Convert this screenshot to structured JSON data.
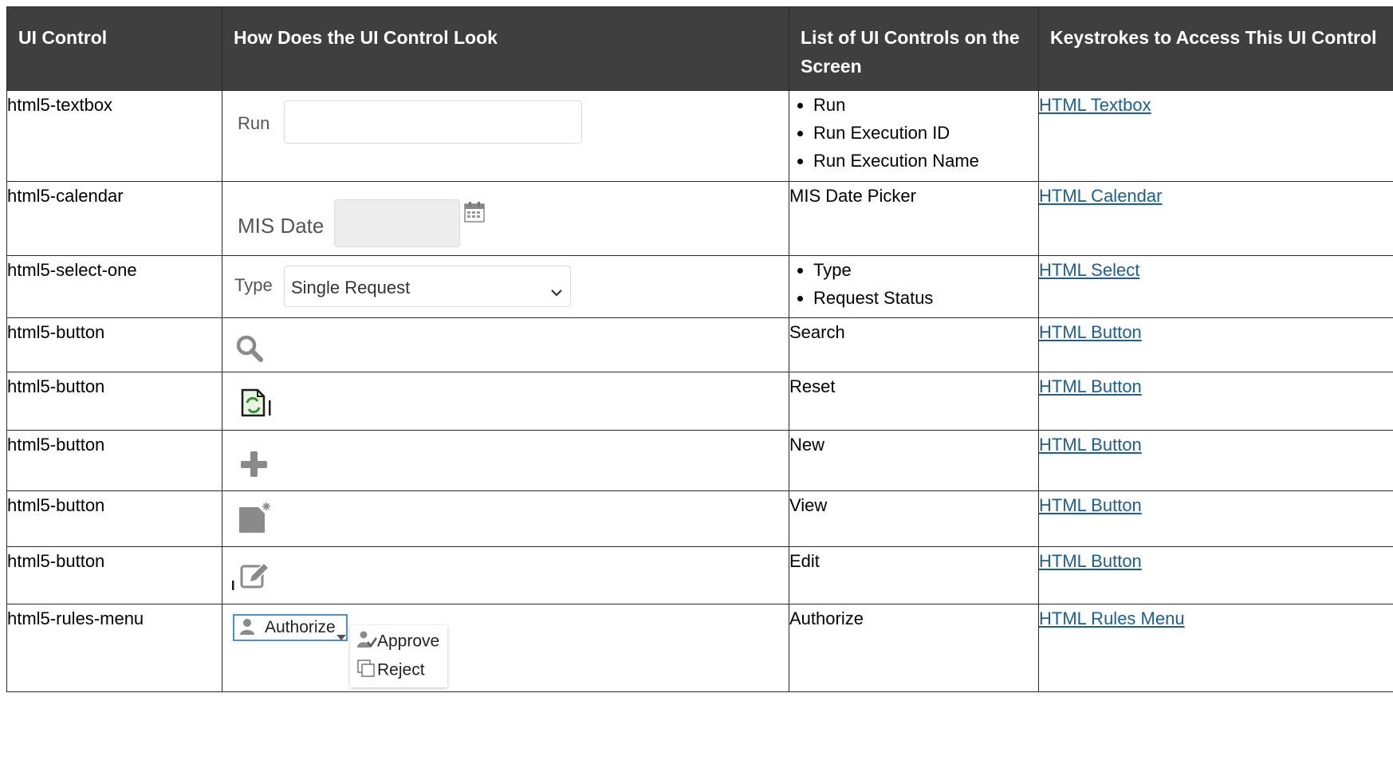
{
  "headers": {
    "ui_control": "UI Control",
    "look": "How Does the UI Control Look",
    "list": "List of UI Controls on the Screen",
    "keys": "Keystrokes to Access This UI Control"
  },
  "rows": [
    {
      "control": "html5-textbox",
      "look": {
        "label": "Run"
      },
      "list_items": [
        "Run",
        "Run Execution ID",
        "Run Execution Name"
      ],
      "link": "HTML Textbox"
    },
    {
      "control": "html5-calendar",
      "look": {
        "label": "MIS Date",
        "icon": "calendar-icon"
      },
      "list_text": "MIS Date Picker",
      "link": "HTML Calendar"
    },
    {
      "control": "html5-select-one",
      "look": {
        "label": "Type",
        "value": "Single Request",
        "icon": "chevron-down-icon"
      },
      "list_items": [
        "Type",
        "Request Status"
      ],
      "link": "HTML Select"
    },
    {
      "control": "html5-button",
      "look": {
        "icon": "search-icon"
      },
      "list_text": "Search",
      "link": "HTML Button"
    },
    {
      "control": "html5-button",
      "look": {
        "icon": "reset-icon"
      },
      "list_text": "Reset",
      "link": "HTML Button"
    },
    {
      "control": "html5-button",
      "look": {
        "icon": "plus-icon"
      },
      "list_text": "New",
      "link": "HTML Button"
    },
    {
      "control": "html5-button",
      "look": {
        "icon": "view-icon"
      },
      "list_text": "View",
      "link": "HTML Button"
    },
    {
      "control": "html5-button",
      "look": {
        "icon": "edit-icon"
      },
      "list_text": "Edit",
      "link": "HTML Button"
    },
    {
      "control": "html5-rules-menu",
      "look": {
        "button_label": "Authorize",
        "menu_items": [
          "Approve",
          "Reject"
        ],
        "icons": [
          "user-icon",
          "approve-icon",
          "reject-icon"
        ]
      },
      "list_text": "Authorize",
      "link": "HTML Rules Menu"
    }
  ],
  "colors": {
    "header_bg": "#3f3f3f",
    "link": "#1a5e9a",
    "rule_border": "#4a8fd8"
  }
}
